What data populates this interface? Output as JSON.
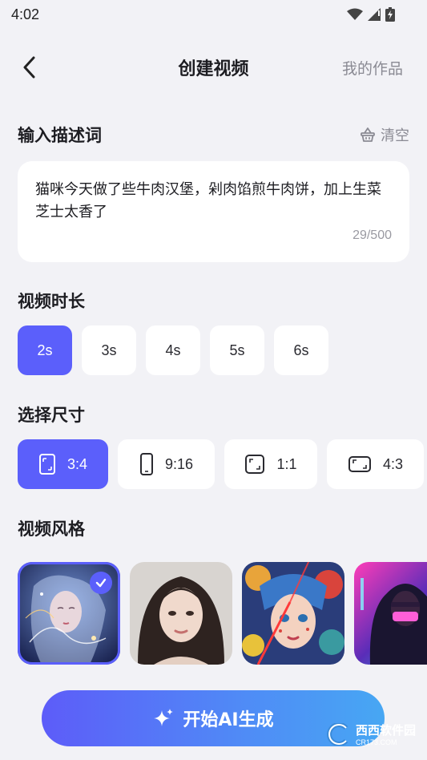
{
  "status_bar": {
    "time": "4:02"
  },
  "nav": {
    "title": "创建视频",
    "right_link": "我的作品"
  },
  "prompt_section": {
    "title": "输入描述词",
    "clear_label": "清空",
    "text": "猫咪今天做了些牛肉汉堡，剁肉馅煎牛肉饼，加上生菜芝士太香了",
    "count": "29/500"
  },
  "duration_section": {
    "title": "视频时长",
    "options": [
      "2s",
      "3s",
      "4s",
      "5s",
      "6s"
    ],
    "selected": "2s"
  },
  "size_section": {
    "title": "选择尺寸",
    "options": [
      "3:4",
      "9:16",
      "1:1",
      "4:3"
    ],
    "selected": "3:4"
  },
  "style_section": {
    "title": "视频风格",
    "cards": [
      {
        "icon": "ethereal-portrait-thumbnail",
        "selected": true
      },
      {
        "icon": "realistic-portrait-thumbnail",
        "selected": false
      },
      {
        "icon": "colorful-illustration-thumbnail",
        "selected": false
      },
      {
        "icon": "cyberpunk-hoodie-thumbnail",
        "selected": false
      }
    ]
  },
  "generate_button": {
    "label": "开始AI生成"
  },
  "watermark": {
    "text": "西西软件园",
    "sub": "CR173.COM"
  },
  "colors": {
    "accent": "#5b5ffb",
    "background": "#f2f2f6",
    "card": "#ffffff",
    "muted": "#8a8a93"
  }
}
